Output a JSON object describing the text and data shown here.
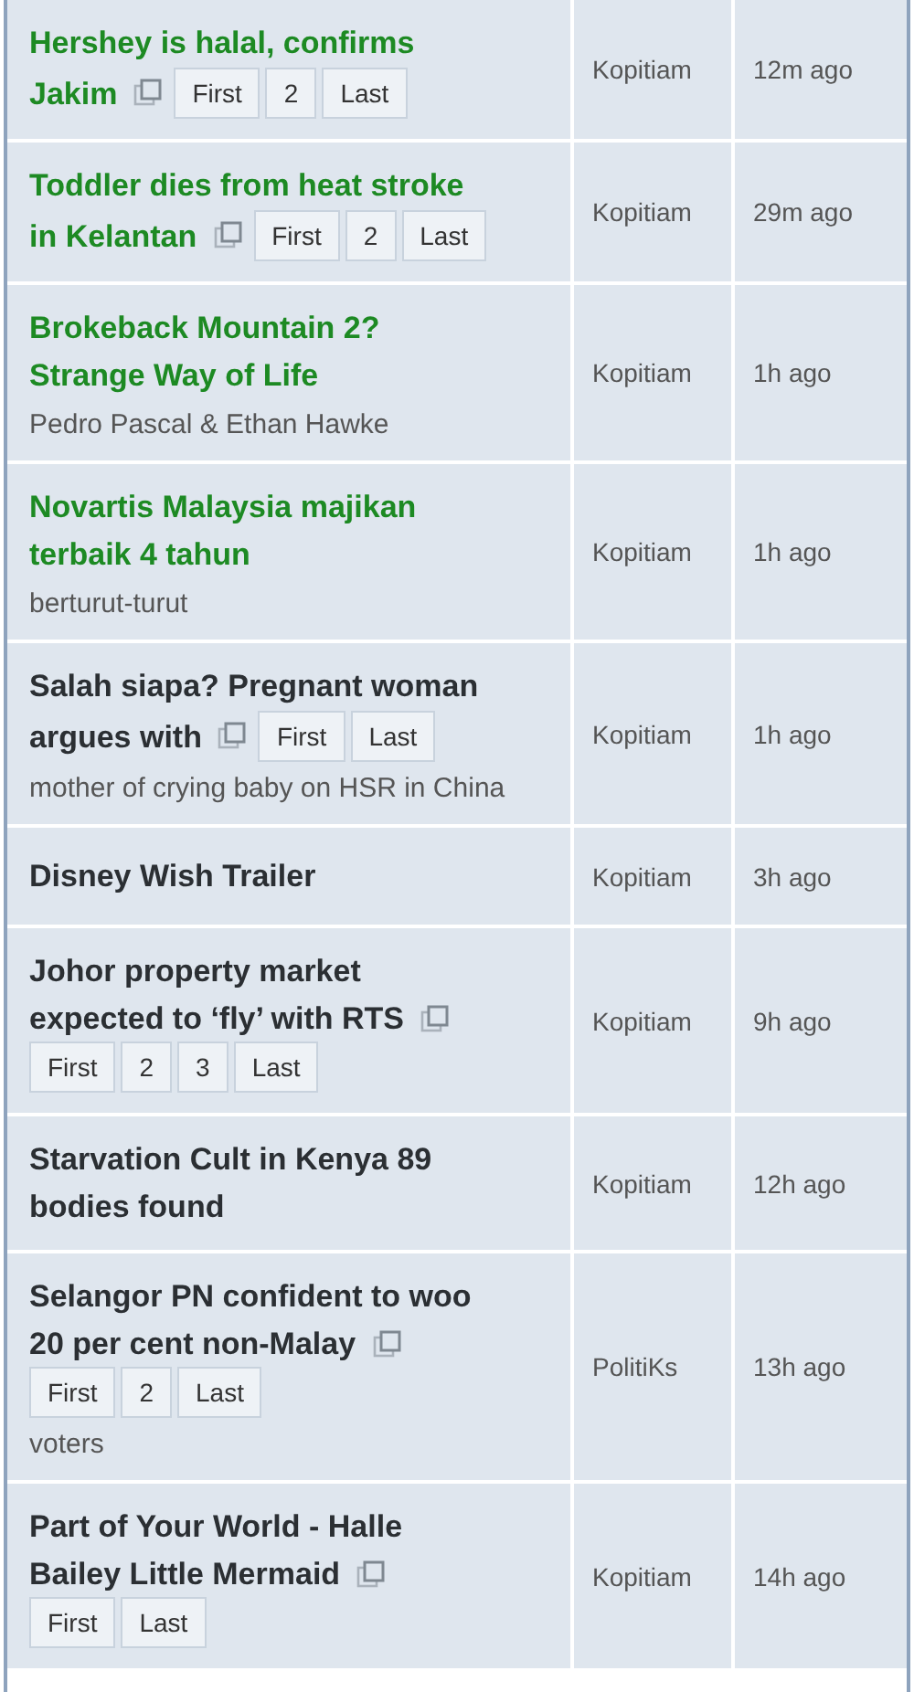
{
  "threads": [
    {
      "title": [
        "Hershey is halal, confirms",
        "Jakim"
      ],
      "highlighted": true,
      "pages": [
        "First",
        "2",
        "Last"
      ],
      "forum": "Kopitiam",
      "time": "12m ago"
    },
    {
      "title": [
        "Toddler dies from heat stroke",
        "in Kelantan"
      ],
      "highlighted": true,
      "pages": [
        "First",
        "2",
        "Last"
      ],
      "forum": "Kopitiam",
      "time": "29m ago"
    },
    {
      "title": [
        "Brokeback Mountain 2?",
        "Strange Way of Life"
      ],
      "highlighted": true,
      "subtitle": "Pedro Pascal & Ethan Hawke",
      "forum": "Kopitiam",
      "time": "1h ago"
    },
    {
      "title": [
        "Novartis Malaysia majikan",
        "terbaik 4 tahun"
      ],
      "highlighted": true,
      "subtitle": "berturut-turut",
      "forum": "Kopitiam",
      "time": "1h ago"
    },
    {
      "title": [
        "Salah siapa? Pregnant woman",
        "argues with"
      ],
      "highlighted": false,
      "pages": [
        "First",
        "Last"
      ],
      "subtitle": "mother of crying baby on HSR in China",
      "forum": "Kopitiam",
      "time": "1h ago"
    },
    {
      "title": [
        "Disney Wish Trailer"
      ],
      "highlighted": false,
      "forum": "Kopitiam",
      "time": "3h ago"
    },
    {
      "title": [
        "Johor property market",
        "expected to ‘fly’ with RTS"
      ],
      "highlighted": false,
      "pages": [
        "First",
        "2",
        "3",
        "Last"
      ],
      "forum": "Kopitiam",
      "time": "9h ago"
    },
    {
      "title": [
        "Starvation Cult in Kenya 89",
        "bodies found"
      ],
      "highlighted": false,
      "forum": "Kopitiam",
      "time": "12h ago"
    },
    {
      "title": [
        "Selangor PN confident to woo",
        "20 per cent non-Malay"
      ],
      "highlighted": false,
      "pages": [
        "First",
        "2",
        "Last"
      ],
      "subtitle": "voters",
      "forum": "PolitiKs",
      "time": "13h ago"
    },
    {
      "title": [
        "Part of Your World - Halle",
        "Bailey Little Mermaid"
      ],
      "highlighted": false,
      "pages": [
        "First",
        "Last"
      ],
      "forum": "Kopitiam",
      "time": "14h ago"
    }
  ]
}
